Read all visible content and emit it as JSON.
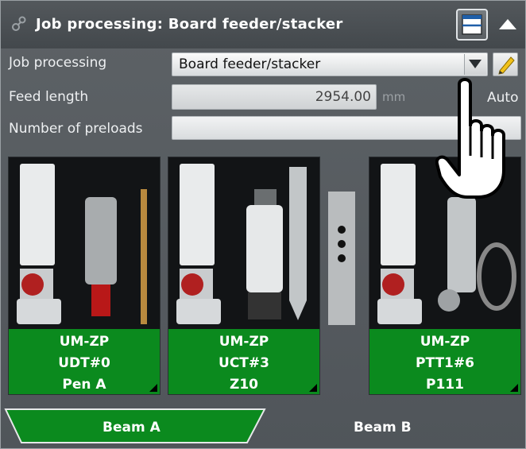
{
  "header": {
    "title": "Job processing: Board feeder/stacker",
    "icon": "link-icon"
  },
  "form": {
    "job_processing": {
      "label": "Job processing",
      "value": "Board feeder/stacker"
    },
    "feed_length": {
      "label": "Feed length",
      "value": "2954.00",
      "unit": "mm",
      "auto_label": "Auto"
    },
    "preloads": {
      "label": "Number of preloads",
      "value": ""
    }
  },
  "tools": [
    {
      "line1": "UM-ZP",
      "line2": "UDT#0",
      "line3": "Pen A"
    },
    {
      "line1": "UM-ZP",
      "line2": "UCT#3",
      "line3": "Z10"
    },
    {
      "line1": "UM-ZP",
      "line2": "PTT1#6",
      "line3": "P111"
    }
  ],
  "tabs": {
    "beam_a": "Beam A",
    "beam_b": "Beam B"
  },
  "colors": {
    "accent_green": "#0b8a1e",
    "panel": "#565b5f"
  }
}
